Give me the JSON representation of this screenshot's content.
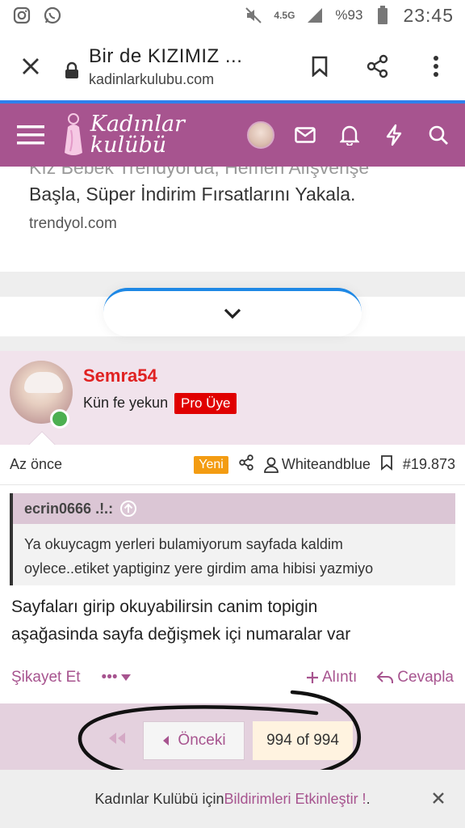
{
  "status_bar": {
    "network": "4.5G",
    "battery": "%93",
    "time": "23:45"
  },
  "browser": {
    "title": "Bir de KIZIMIZ ...",
    "domain": "kadinlarkulubu.com"
  },
  "site_header": {
    "logo_line1": "Kadınlar",
    "logo_line2": "kulübü",
    "brand_color": "#a7548f"
  },
  "ad": {
    "line1": "Kız Bebek Trendyol'da, Hemen Alışverişe",
    "line2": "Başla, Süper İndirim Fırsatlarını Yakala.",
    "domain": "trendyol.com"
  },
  "post": {
    "username": "Semra54",
    "user_title": "Kün fe yekun",
    "badge": "Pro Üye",
    "time": "Az önce",
    "new_badge": "Yeni",
    "mentioned_user": "Whiteandblue",
    "post_number": "#19.873",
    "quote_author": "ecrin0666 .!.:",
    "quote_text_1": "Ya okuycagm yerleri bulamiyorum sayfada kaldim",
    "quote_text_2": "oylece..etiket yaptiginz yere girdim ama hibisi yazmiyo",
    "reply_line1": "Sayfaları girip okuyabilirsin canim topigin",
    "reply_line2": "aşağasinda sayfa değişmek içi numaralar var",
    "report_label": "Şikayet Et",
    "more_label": "•••",
    "quote_label": "Alıntı",
    "reply_label": "Cevapla"
  },
  "pagination": {
    "prev_label": "Önceki",
    "page_label": "994 of 994"
  },
  "notification": {
    "prefix": "Kadınlar Kulübü için ",
    "link": "Bildirimleri Etkinleştir !",
    "suffix": "."
  }
}
